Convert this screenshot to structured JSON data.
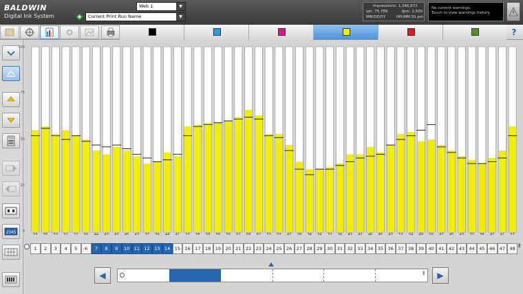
{
  "header": {
    "brand": "BALDWIN",
    "product": "Digital Ink System",
    "web_value": "Web 1",
    "run_value": "Current Print Run Name",
    "stats": {
      "impressions": "Impressions: 1,346,872",
      "iph": "iph: 75,789",
      "fpm": "fpm: 2,500",
      "date": "MM/DD/YY",
      "time": "HH:MM:SS pm"
    },
    "warnings": {
      "line1": "No current warnings.",
      "line2": "Touch to view warnings history."
    }
  },
  "toolbar": {
    "ink_tabs": [
      {
        "name": "black",
        "color": "#000000",
        "active": false
      },
      {
        "name": "cyan",
        "color": "#1aa3e8",
        "active": false
      },
      {
        "name": "magenta",
        "color": "#e0148c",
        "active": false
      },
      {
        "name": "yellow",
        "color": "#f2ee00",
        "active": true
      },
      {
        "name": "red",
        "color": "#e8141e",
        "active": false
      },
      {
        "name": "green",
        "color": "#5a8c32",
        "active": false
      }
    ],
    "help_label": "?"
  },
  "colors": {
    "accent": "#2666b0",
    "bar_fill": "#f2ee00",
    "bar_track": "#ffffff"
  },
  "chart_data": {
    "type": "bar",
    "ylim": [
      0,
      100
    ],
    "yticks": [
      "100",
      "75",
      "50",
      "25",
      "0"
    ],
    "categories": [
      "1",
      "2",
      "3",
      "4",
      "5",
      "6",
      "7",
      "8",
      "9",
      "10",
      "11",
      "12",
      "13",
      "14",
      "15",
      "16",
      "17",
      "18",
      "19",
      "20",
      "21",
      "22",
      "23",
      "24",
      "25",
      "26",
      "27",
      "28",
      "29",
      "30",
      "31",
      "32",
      "33",
      "34",
      "35",
      "36",
      "37",
      "38",
      "39",
      "40",
      "41",
      "42",
      "43",
      "44",
      "45",
      "46",
      "47",
      "48"
    ],
    "values": [
      55,
      57,
      53,
      55,
      52,
      50,
      44,
      42,
      46,
      44,
      41,
      37,
      38,
      43,
      41,
      57,
      58,
      59,
      59,
      60,
      62,
      66,
      63,
      53,
      53,
      47,
      38,
      34,
      34,
      35,
      37,
      42,
      42,
      46,
      43,
      47,
      53,
      54,
      49,
      50,
      47,
      44,
      41,
      39,
      37,
      40,
      44,
      57
    ],
    "targets": [
      52,
      56,
      52,
      50,
      52,
      49,
      47,
      46,
      47,
      45,
      42,
      40,
      38,
      39,
      42,
      52,
      57,
      58,
      59,
      60,
      61,
      62,
      61,
      52,
      51,
      44,
      34,
      31,
      34,
      34,
      36,
      38,
      40,
      41,
      42,
      47,
      50,
      52,
      55,
      58,
      46,
      43,
      40,
      37,
      37,
      38,
      40,
      52
    ],
    "value_labels": [
      "53",
      "55",
      "53",
      "52",
      "52",
      "50",
      "44",
      "43",
      "47",
      "45",
      "43",
      "37",
      "39",
      "44",
      "41",
      "57",
      "58",
      "58",
      "58",
      "59",
      "62",
      "68",
      "62",
      "53",
      "53",
      "47",
      "38",
      "34",
      "34",
      "33",
      "34",
      "43",
      "42",
      "46",
      "45",
      "47",
      "53",
      "54",
      "49",
      "50",
      "47",
      "45",
      "43",
      "37",
      "38",
      "42",
      "41",
      "57"
    ]
  },
  "zones": {
    "numbers": [
      "1",
      "2",
      "3",
      "4",
      "5",
      "6",
      "7",
      "8",
      "9",
      "10",
      "11",
      "12",
      "13",
      "14",
      "15",
      "16",
      "17",
      "18",
      "19",
      "20",
      "21",
      "22",
      "23",
      "24",
      "25",
      "26",
      "27",
      "28",
      "29",
      "30",
      "31",
      "32",
      "33",
      "34",
      "35",
      "36",
      "37",
      "38",
      "39",
      "40",
      "41",
      "42",
      "43",
      "44",
      "45",
      "46",
      "47",
      "48"
    ],
    "selected_from": 7,
    "selected_to": 14
  },
  "scroller": {
    "prev_label": "◀",
    "next_label": "▶",
    "window_fraction": 0.167,
    "window_start_fraction": 0.167
  }
}
